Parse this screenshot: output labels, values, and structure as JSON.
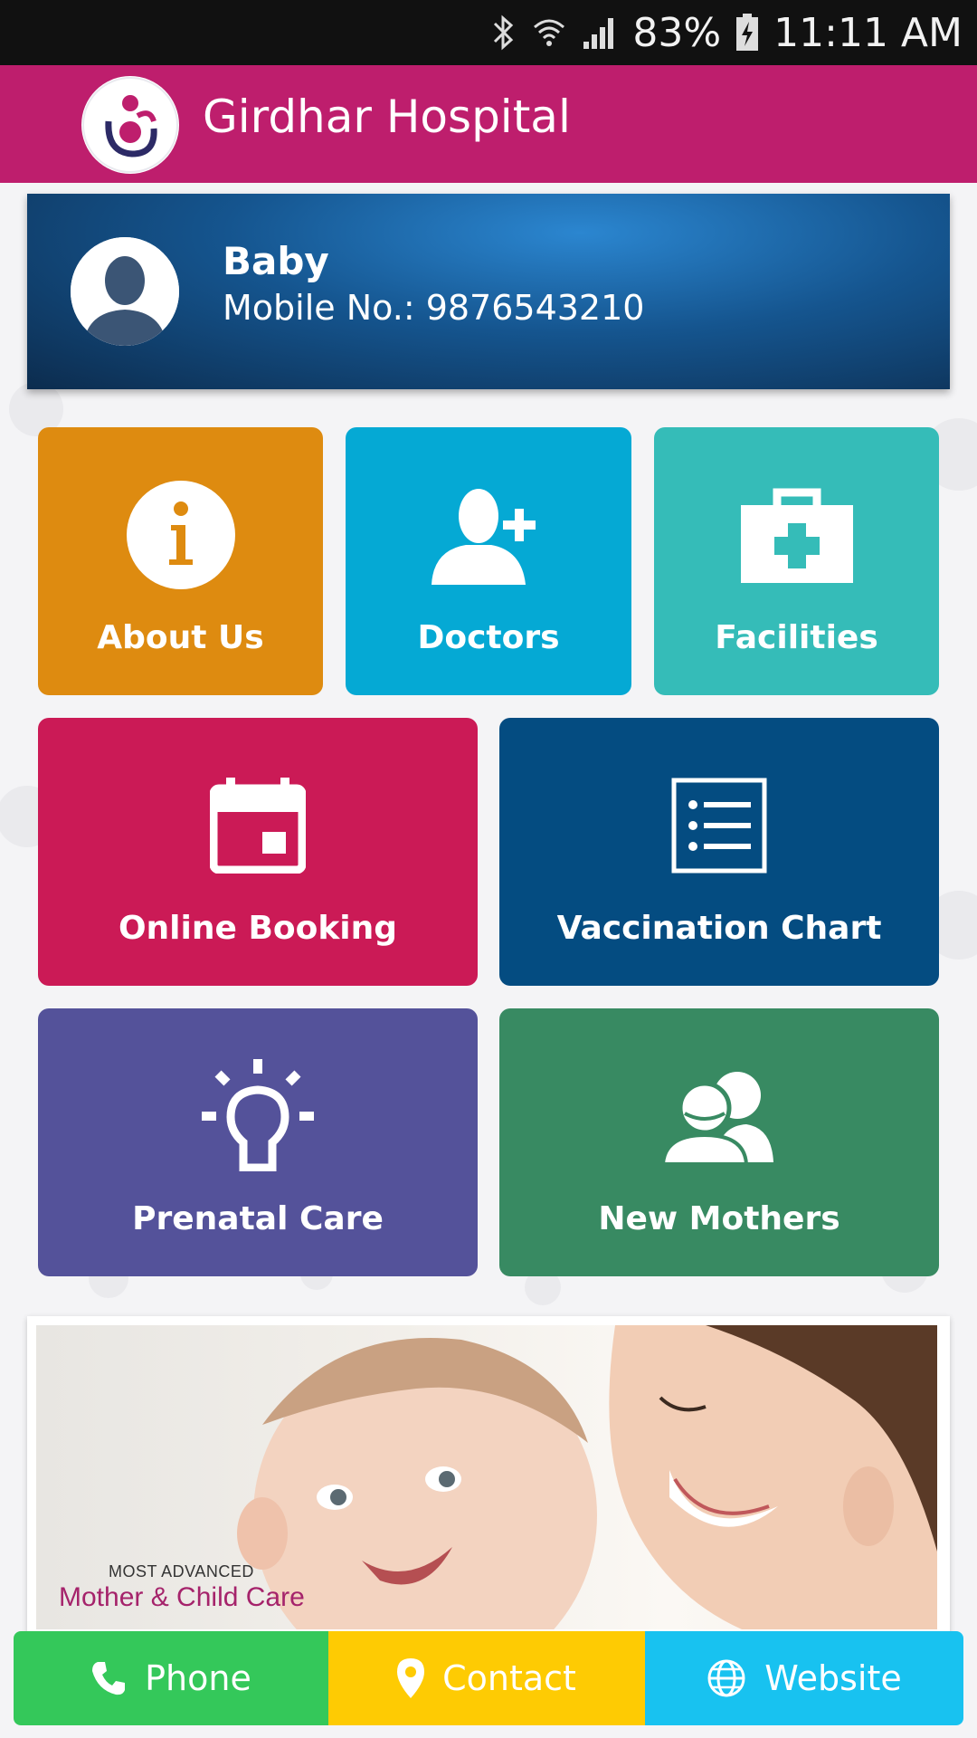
{
  "status_bar": {
    "battery": "83%",
    "time": "11:11 AM"
  },
  "app": {
    "title": "Girdhar Hospital"
  },
  "profile": {
    "name": "Baby",
    "mobile": "Mobile No.: 9876543210"
  },
  "tiles": [
    {
      "label": "About Us",
      "icon": "info-icon",
      "color": "#de8b10"
    },
    {
      "label": "Doctors",
      "icon": "add-doctor-icon",
      "color": "#05a9d4"
    },
    {
      "label": "Facilities",
      "icon": "first-aid-kit-icon",
      "color": "#35bcb8"
    },
    {
      "label": "Online Booking",
      "icon": "calendar-icon",
      "color": "#cb1a56"
    },
    {
      "label": "Vaccination Chart",
      "icon": "list-icon",
      "color": "#044c81"
    },
    {
      "label": "Prenatal Care",
      "icon": "lightbulb-icon",
      "color": "#54529a"
    },
    {
      "label": "New Mothers",
      "icon": "users-icon",
      "color": "#388a62"
    }
  ],
  "banner": {
    "tagline_small": "MOST ADVANCED",
    "tagline_big": "Mother & Child Care"
  },
  "bottom_bar": [
    {
      "label": "Phone",
      "icon": "phone-icon",
      "color": "#34c85a"
    },
    {
      "label": "Contact",
      "icon": "location-pin-icon",
      "color": "#fecb03"
    },
    {
      "label": "Website",
      "icon": "globe-icon",
      "color": "#18c2f0"
    }
  ]
}
